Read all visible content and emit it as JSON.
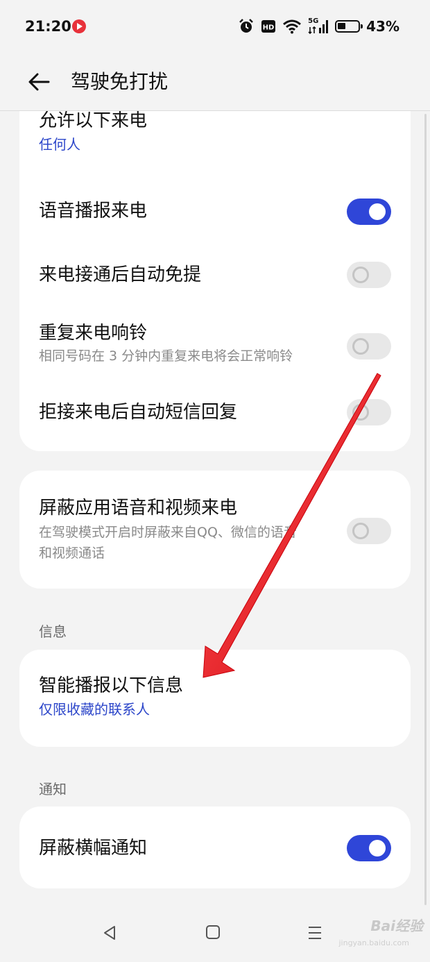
{
  "status_bar": {
    "time": "21:20",
    "network": "5G",
    "battery_percent": "43%",
    "icons": [
      "record-icon",
      "alarm-icon",
      "hd-icon",
      "wifi-icon",
      "signal-icon",
      "battery-icon"
    ]
  },
  "header": {
    "title": "驾驶免打扰"
  },
  "calls": {
    "allow_calls": {
      "title": "允许以下来电",
      "value": "任何人"
    },
    "voice_announce": {
      "title": "语音播报来电",
      "enabled": true
    },
    "auto_speaker": {
      "title": "来电接通后自动免提",
      "enabled": false
    },
    "repeat_ring": {
      "title": "重复来电响铃",
      "desc": "相同号码在 3 分钟内重复来电将会正常响铃",
      "enabled": false
    },
    "auto_sms": {
      "title": "拒接来电后自动短信回复",
      "enabled": false
    }
  },
  "app_calls": {
    "block_app_calls": {
      "title": "屏蔽应用语音和视频来电",
      "desc_line1": "在驾驶模式开启时屏蔽来自QQ、微信的语音",
      "desc_line2": "和视频通话",
      "enabled": false
    }
  },
  "messages": {
    "section_label": "信息",
    "smart_announce": {
      "title": "智能播报以下信息",
      "value": "仅限收藏的联系人"
    }
  },
  "notifications": {
    "section_label": "通知",
    "block_banner": {
      "title": "屏蔽横幅通知",
      "enabled": true
    }
  },
  "colors": {
    "accent": "#2f46d8",
    "link": "#2b45c9",
    "annotation_arrow": "#e8141c"
  },
  "watermark": {
    "brand": "Bai经验",
    "url": "jingyan.baidu.com"
  }
}
